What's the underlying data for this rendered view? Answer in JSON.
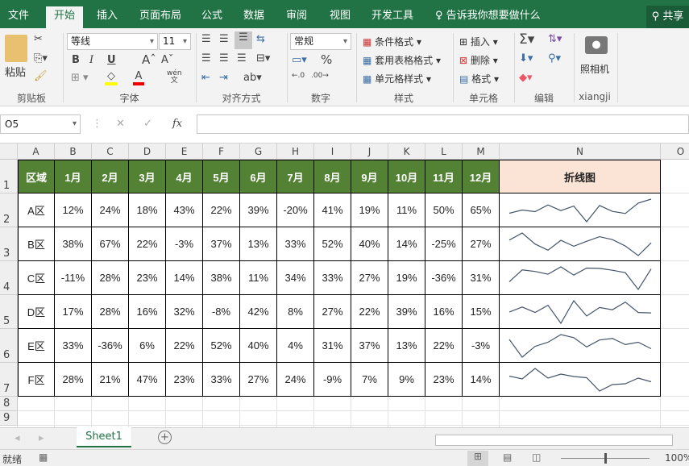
{
  "tabs": [
    {
      "label": "文件"
    },
    {
      "label": "开始",
      "active": true
    },
    {
      "label": "插入"
    },
    {
      "label": "页面布局"
    },
    {
      "label": "公式"
    },
    {
      "label": "数据"
    },
    {
      "label": "审阅"
    },
    {
      "label": "视图"
    },
    {
      "label": "开发工具"
    }
  ],
  "tellme": "告诉我你想要做什么",
  "share": "共享",
  "ribbon": {
    "paste": "粘贴",
    "clipboard": "剪贴板",
    "font_name": "等线",
    "font_size": "11",
    "font_group": "字体",
    "bold": "B",
    "italic": "I",
    "underline": "U",
    "wen": "wén",
    "align_group": "对齐方式",
    "number_format": "常规",
    "number_group": "数字",
    "percent": "%",
    "cond_format": "条件格式",
    "table_format": "套用表格格式",
    "cell_style": "单元格样式",
    "style_group": "样式",
    "insert": "插入",
    "delete": "删除",
    "format": "格式",
    "cells_group": "单元格",
    "edit_group": "编辑",
    "camera": "照相机",
    "xiangji_group": "xiangji"
  },
  "name_box": "O5",
  "fx": "fx",
  "columns": [
    "A",
    "B",
    "C",
    "D",
    "E",
    "F",
    "G",
    "H",
    "I",
    "J",
    "K",
    "L",
    "M",
    "N",
    "O"
  ],
  "rows": [
    "1",
    "2",
    "3",
    "4",
    "5",
    "6",
    "7",
    "8",
    "9"
  ],
  "table": {
    "headers": [
      "区域",
      "1月",
      "2月",
      "3月",
      "4月",
      "5月",
      "6月",
      "7月",
      "8月",
      "9月",
      "10月",
      "11月",
      "12月",
      "折线图"
    ],
    "rows": [
      {
        "region": "A区",
        "values": [
          "12%",
          "24%",
          "18%",
          "43%",
          "22%",
          "39%",
          "-20%",
          "41%",
          "19%",
          "11%",
          "50%",
          "65%"
        ]
      },
      {
        "region": "B区",
        "values": [
          "38%",
          "67%",
          "22%",
          "-3%",
          "37%",
          "13%",
          "33%",
          "52%",
          "40%",
          "14%",
          "-25%",
          "27%"
        ]
      },
      {
        "region": "C区",
        "values": [
          "-11%",
          "28%",
          "23%",
          "14%",
          "38%",
          "11%",
          "34%",
          "33%",
          "27%",
          "19%",
          "-36%",
          "31%"
        ]
      },
      {
        "region": "D区",
        "values": [
          "17%",
          "28%",
          "16%",
          "32%",
          "-8%",
          "42%",
          "8%",
          "27%",
          "22%",
          "39%",
          "16%",
          "15%"
        ]
      },
      {
        "region": "E区",
        "values": [
          "33%",
          "-36%",
          "6%",
          "22%",
          "52%",
          "40%",
          "4%",
          "31%",
          "37%",
          "13%",
          "22%",
          "-3%"
        ]
      },
      {
        "region": "F区",
        "values": [
          "28%",
          "21%",
          "47%",
          "23%",
          "33%",
          "27%",
          "24%",
          "-9%",
          "7%",
          "9%",
          "23%",
          "14%"
        ]
      }
    ]
  },
  "colors": {
    "header_green": "#548235",
    "sparkline_header": "#fbe3d6",
    "sparkline": "#44546a",
    "brand": "#217346"
  },
  "sheet_tab": "Sheet1",
  "status": {
    "ready": "就绪",
    "zoom": "100%"
  }
}
